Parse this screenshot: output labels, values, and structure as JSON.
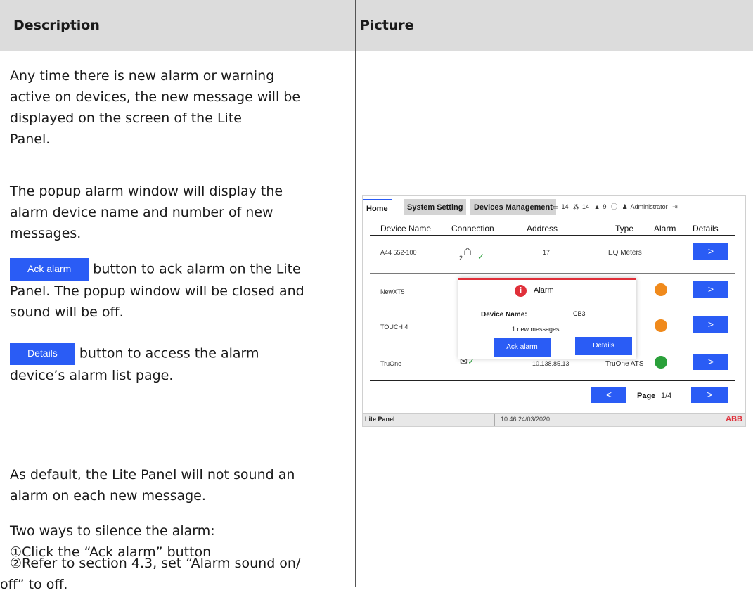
{
  "header": {
    "col1": "Description",
    "col2": "Picture"
  },
  "description": {
    "p1_l1": "Any time there is new alarm or warning",
    "p1_l2": "active on devices, the new message will be",
    "p1_l3": "displayed on the screen of the Lite",
    "p1_l4": "Panel.",
    "p2_l1": "The popup alarm window will display the",
    "p2_l2": "alarm device name and number of new",
    "p2_l3": "messages.",
    "ack_btn": "Ack alarm",
    "p3_l1": " button to ack alarm on the Lite",
    "p3_l2": "Panel. The popup window will be closed and",
    "p3_l3": "sound will be off.",
    "details_btn": "Details",
    "p4_l1": " button to access the alarm",
    "p4_l2": "device’s alarm list page.",
    "p5_l1": "As default, the Lite Panel will not sound an",
    "p5_l2": "alarm on each new message.",
    "p6": "Two ways to silence the alarm:",
    "p7": "①Click the “Ack alarm” button",
    "p8_l1": "②Refer to section 4.3, set “Alarm sound on/",
    "p8_l2": "off” to off."
  },
  "screenshot": {
    "tabs": [
      "Home",
      "System Setting",
      "Devices Management"
    ],
    "icons": {
      "monitor_count": "14",
      "devices_count": "14",
      "bell_count": "9",
      "user": "Administrator"
    },
    "columns": [
      "Device Name",
      "Connection",
      "Address",
      "Type",
      "Alarm",
      "Details"
    ],
    "rows": [
      {
        "name": "A44 552-100",
        "address": "17",
        "type": "EQ Meters",
        "alarm": "none",
        "details": ">",
        "connection_prefix": "2"
      },
      {
        "name": "NewXT5",
        "address": "",
        "type": "",
        "alarm": "#f08a1c",
        "details": ">"
      },
      {
        "name": "TOUCH 4",
        "address": "",
        "type": "",
        "alarm": "#f08a1c",
        "details": ">"
      },
      {
        "name": "TruOne",
        "address": "10.138.85.13",
        "type": "TruOne ATS",
        "alarm": "#2aa03a",
        "details": ">"
      }
    ],
    "popup": {
      "title": "Alarm",
      "device_label": "Device Name:",
      "device_value": "CB3",
      "message": "1 new messages",
      "ack_label": "Ack alarm",
      "details_label": "Details"
    },
    "pager": {
      "prev": "<",
      "next": ">",
      "label": "Page",
      "value": "1/4"
    },
    "footer": {
      "app": "Lite Panel",
      "datetime": "10:46 24/03/2020",
      "brand": "ABB"
    },
    "colors": {
      "accent": "#2a5cf5",
      "alert": "#e0303a",
      "brand": "#e0303a"
    }
  }
}
